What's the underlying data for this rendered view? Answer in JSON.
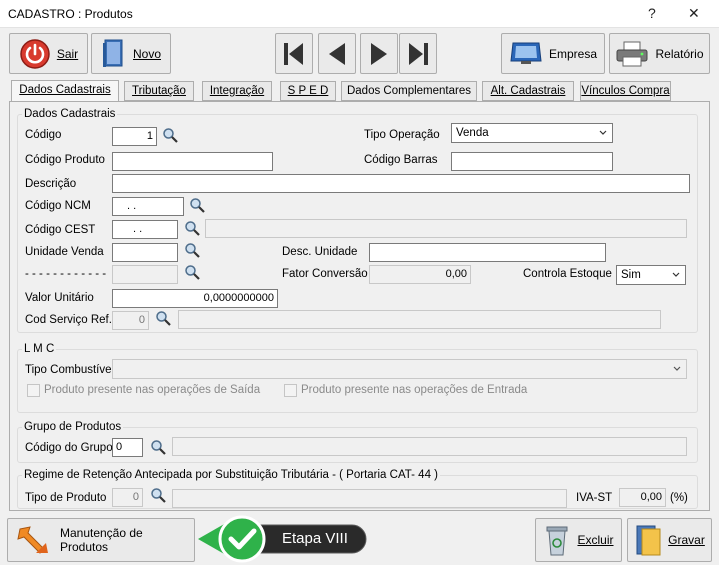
{
  "window": {
    "title": "CADASTRO : Produtos",
    "help_glyph": "?",
    "close_glyph": "✕"
  },
  "toolbar": {
    "sair": "Sair",
    "novo": "Novo",
    "empresa": "Empresa",
    "relatorio": "Relatório"
  },
  "tabs": [
    {
      "label": "Dados Cadastrais"
    },
    {
      "label": "Tributação"
    },
    {
      "label": "Integração"
    },
    {
      "label": "S P E D"
    },
    {
      "label": "Dados Complementares"
    },
    {
      "label": "Alt. Cadastrais"
    },
    {
      "label": "Vínculos Compra"
    }
  ],
  "dados": {
    "group_title": "Dados Cadastrais",
    "codigo_label": "Código",
    "codigo_value": "1",
    "tipo_operacao_label": "Tipo Operação",
    "tipo_operacao_value": "Venda",
    "codigo_produto_label": "Código Produto",
    "codigo_produto_value": "",
    "codigo_barras_label": "Código Barras",
    "codigo_barras_value": "",
    "descricao_label": "Descrição",
    "descricao_value": "",
    "ncm_label": "Código NCM",
    "ncm_value": ". .",
    "cest_label": "Código CEST",
    "cest_value": ". .",
    "unidade_venda_label": "Unidade Venda",
    "unidade_venda_value": "",
    "desc_unidade_label": "Desc. Unidade",
    "desc_unidade_value": "",
    "dashes_label": "- - - - - - - - - - - -",
    "fator_label": "Fator Conversão",
    "fator_value": "0,00",
    "controla_label": "Controla Estoque",
    "controla_value": "Sim",
    "valor_label": "Valor Unitário",
    "valor_value": "0,0000000000",
    "servico_label": "Cod Serviço Ref.",
    "servico_value": "0"
  },
  "lmc": {
    "group_title": "L M C",
    "tipo_label": "Tipo Combustível",
    "tipo_value": "",
    "saida_label": "Produto presente nas operações de Saída",
    "entrada_label": "Produto presente nas operações de Entrada"
  },
  "grupo": {
    "group_title": "Grupo de Produtos",
    "codigo_label": "Código do Grupo",
    "codigo_value": "0"
  },
  "regime": {
    "group_title": "Regime de Retenção Antecipada por Substituição Tributária - ( Portaria CAT- 44 )",
    "tipo_label": "Tipo de Produto",
    "tipo_value": "0",
    "iva_label": "IVA-ST",
    "iva_value": "0,00",
    "pct": "(%)"
  },
  "bottom": {
    "manutencao": "Manutenção de Produtos",
    "etapa": "Etapa VIII",
    "excluir": "Excluir",
    "gravar": "Gravar"
  },
  "colors": {
    "accent_green": "#2fb24a",
    "badge_dark": "#2a2a2a",
    "sair_red": "#d83a2e"
  }
}
